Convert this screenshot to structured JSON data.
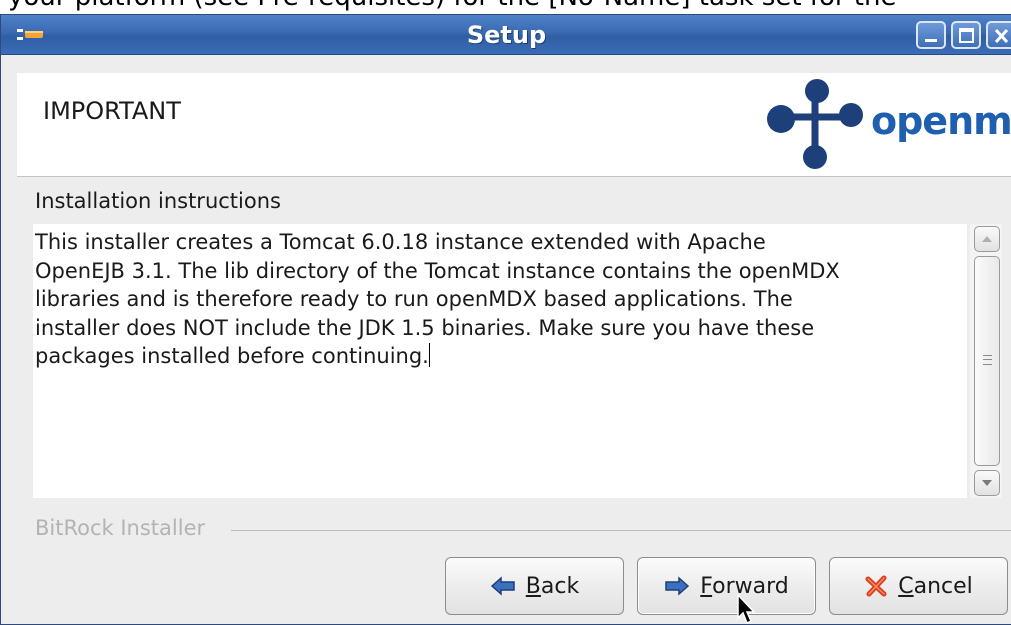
{
  "top_strip_text": "your platform (see Pre-requisites) for the [No-Name] task set for the",
  "window": {
    "title": "Setup"
  },
  "header": {
    "title": "IMPORTANT",
    "logo_text": "openmdx"
  },
  "content": {
    "section_label": "Installation instructions",
    "instructions": "This installer creates a Tomcat 6.0.18 instance extended with Apache\nOpenEJB 3.1. The lib directory of the Tomcat instance contains the openMDX\nlibraries and is therefore ready to run openMDX based applications. The\ninstaller does NOT include the JDK 1.5 binaries. Make sure you have these\npackages installed before continuing."
  },
  "footer": {
    "brand": "BitRock Installer",
    "buttons": {
      "back": {
        "mnemonic": "B",
        "rest": "ack"
      },
      "forward": {
        "mnemonic": "F",
        "rest": "orward"
      },
      "cancel": {
        "mnemonic": "C",
        "rest": "ancel"
      }
    }
  },
  "colors": {
    "titlebar": "#3a6ab2",
    "logo_blue": "#1f5fb0",
    "logo_node": "#1d3f7a",
    "cancel_icon": "#d9401f",
    "arrow_icon": "#3b6fc0"
  },
  "icons": {
    "title": "setup-app-icon",
    "back": "arrow-left-icon",
    "forward": "arrow-right-icon",
    "cancel": "x-icon"
  }
}
